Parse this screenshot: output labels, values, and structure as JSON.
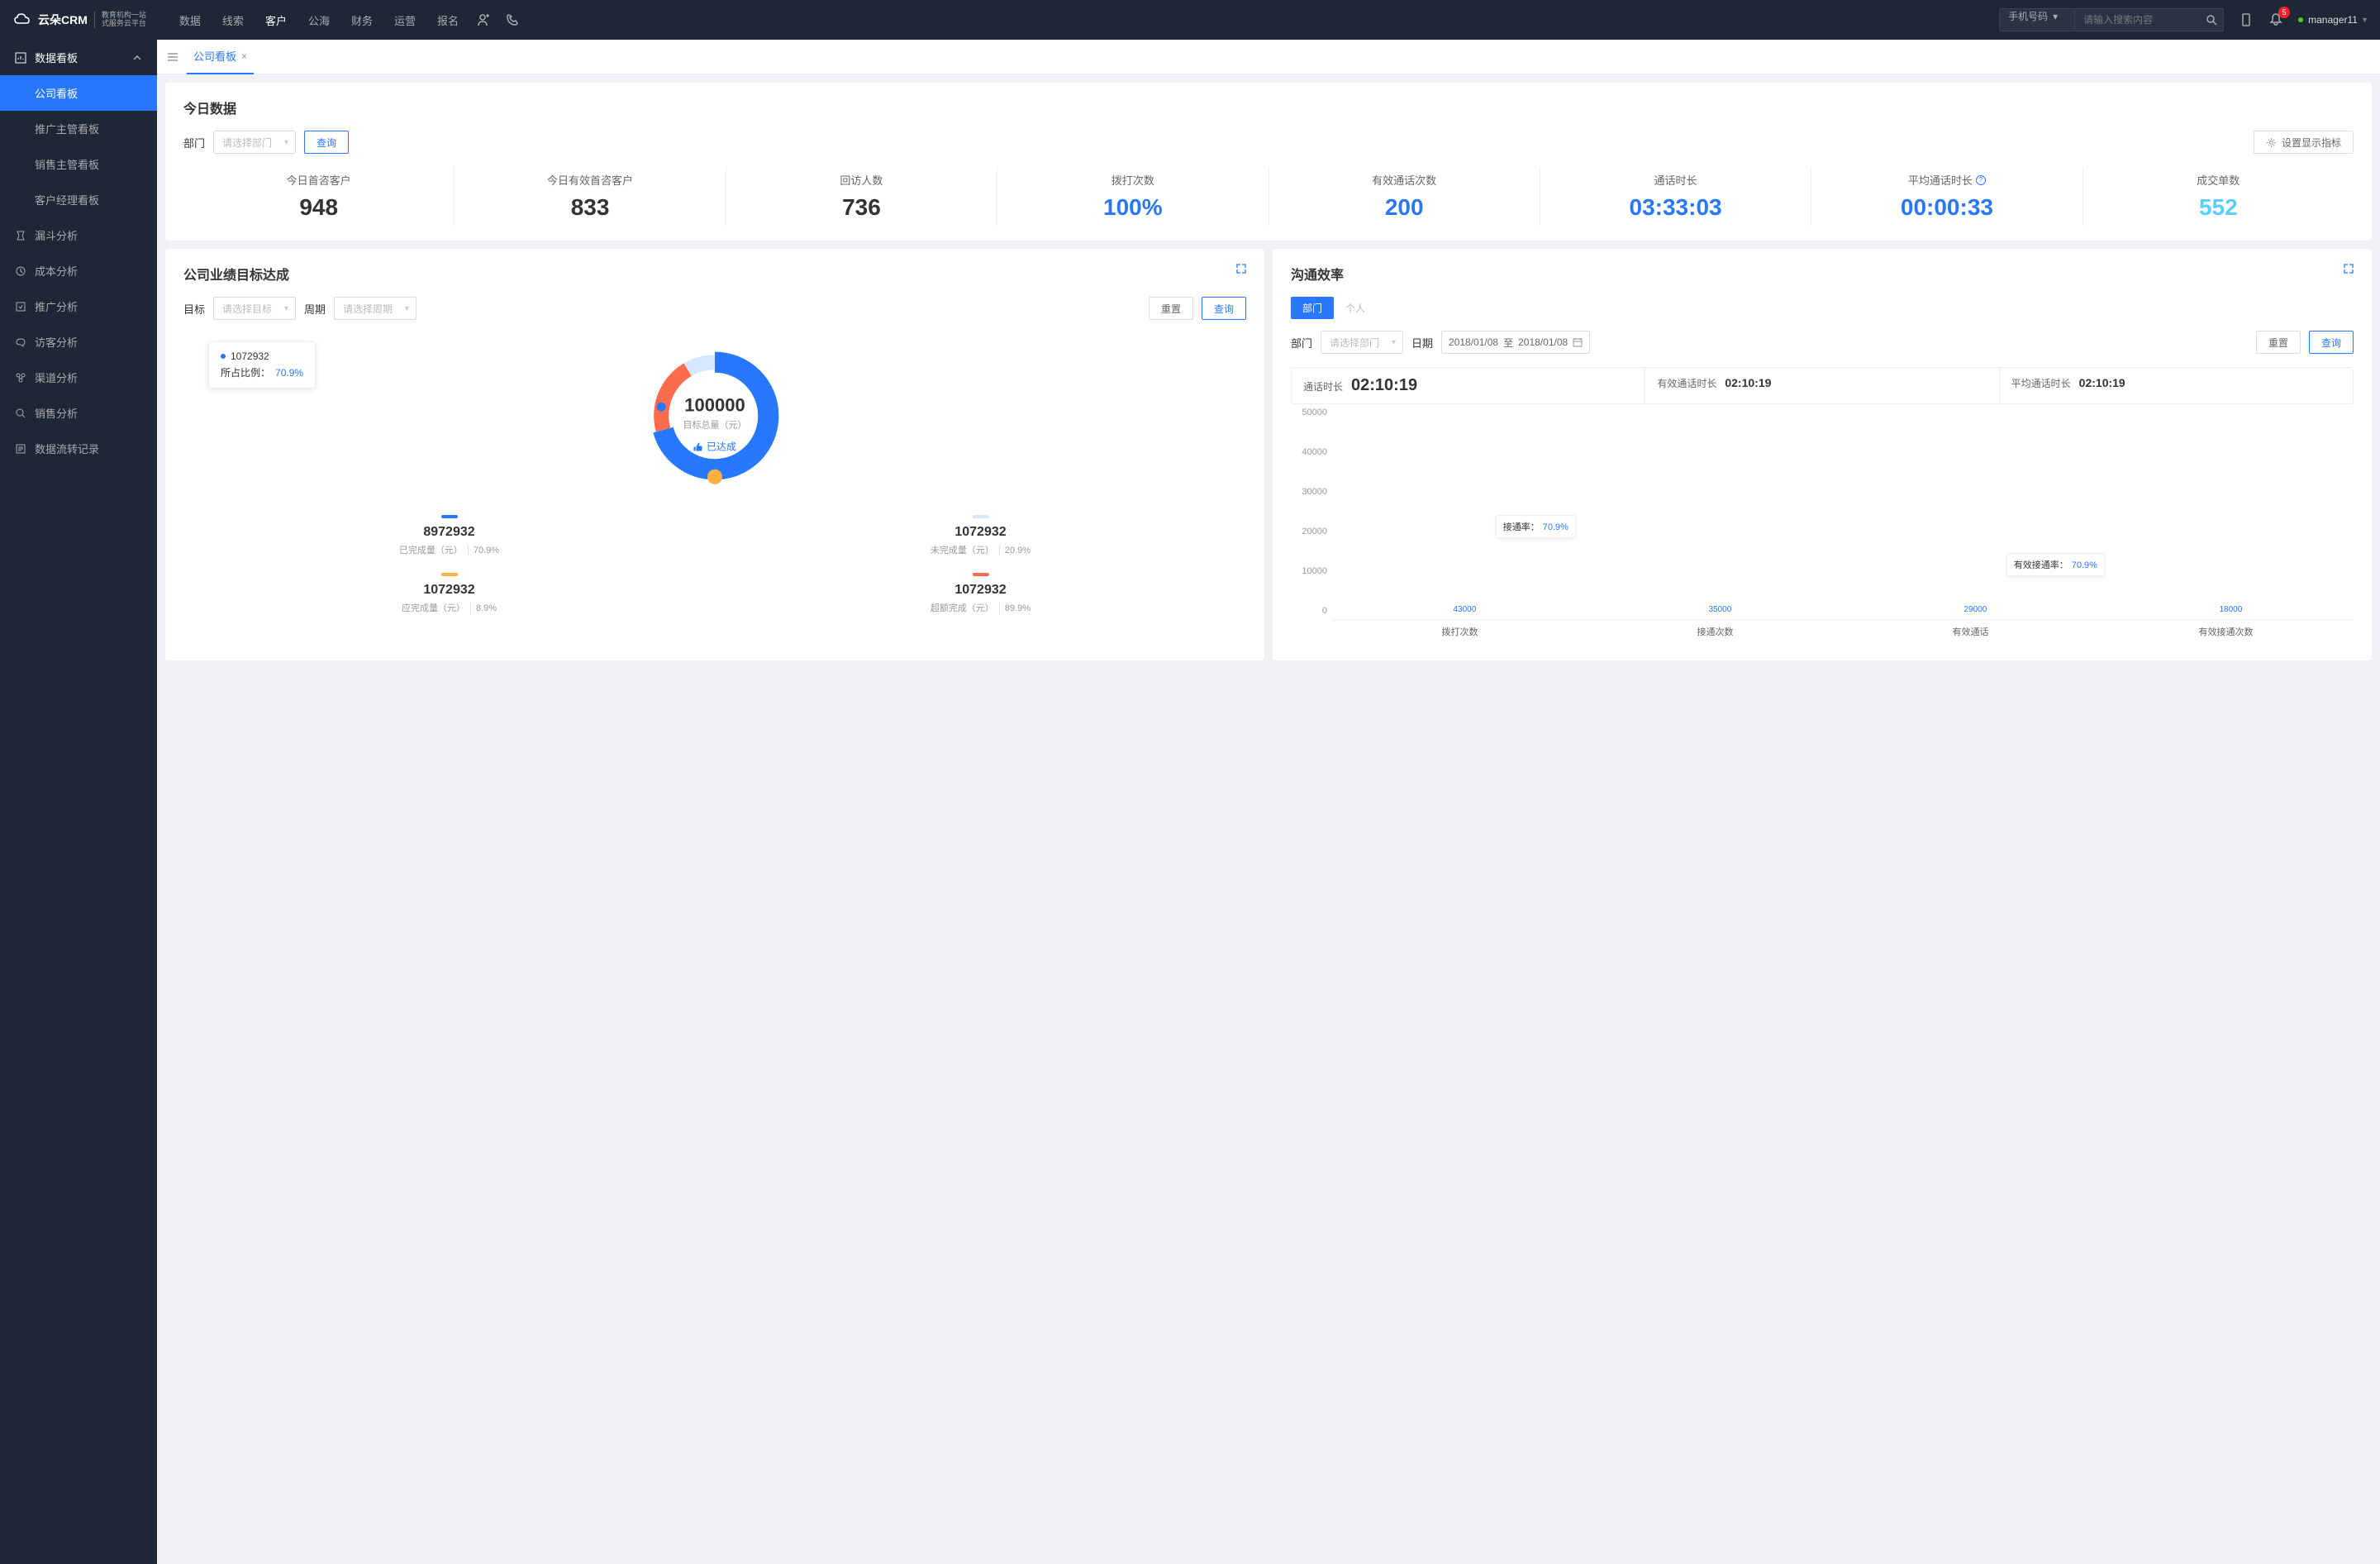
{
  "header": {
    "logo": "云朵CRM",
    "logo_sub": "教育机构一站\n式服务云平台",
    "nav": [
      "数据",
      "线索",
      "客户",
      "公海",
      "财务",
      "运营",
      "报名"
    ],
    "active_nav": 2,
    "search_type": "手机号码",
    "search_placeholder": "请输入搜索内容",
    "badge": "5",
    "user": "manager11"
  },
  "sidebar": {
    "category": "数据看板",
    "subs": [
      "公司看板",
      "推广主管看板",
      "销售主管看板",
      "客户经理看板"
    ],
    "active_sub": 0,
    "items": [
      "漏斗分析",
      "成本分析",
      "推广分析",
      "访客分析",
      "渠道分析",
      "销售分析",
      "数据流转记录"
    ]
  },
  "tabs": {
    "active": "公司看板"
  },
  "today": {
    "title": "今日数据",
    "filter_label": "部门",
    "filter_placeholder": "请选择部门",
    "query_btn": "查询",
    "settings_btn": "设置显示指标",
    "kpis": [
      {
        "label": "今日首咨客户",
        "value": "948",
        "color": "#333"
      },
      {
        "label": "今日有效首咨客户",
        "value": "833",
        "color": "#333"
      },
      {
        "label": "回访人数",
        "value": "736",
        "color": "#333"
      },
      {
        "label": "拨打次数",
        "value": "100%",
        "color": "#2878ff"
      },
      {
        "label": "有效通话次数",
        "value": "200",
        "color": "#2878ff"
      },
      {
        "label": "通话时长",
        "value": "03:33:03",
        "color": "#2878ff"
      },
      {
        "label": "平均通话时长",
        "value": "00:00:33",
        "color": "#2878ff",
        "help": true
      },
      {
        "label": "成交单数",
        "value": "552",
        "color": "#5acfff"
      }
    ]
  },
  "goal": {
    "title": "公司业绩目标达成",
    "target_label": "目标",
    "target_placeholder": "请选择目标",
    "period_label": "周期",
    "period_placeholder": "请选择周期",
    "reset_btn": "重置",
    "query_btn": "查询",
    "tooltip_value": "1072932",
    "tooltip_ratio_label": "所占比例：",
    "tooltip_ratio": "70.9%",
    "center_value": "100000",
    "center_label": "目标总量（元）",
    "status": "已达成",
    "legends": [
      {
        "bar": "#2878ff",
        "value": "8972932",
        "label": "已完成量（元）",
        "pct": "70.9%"
      },
      {
        "bar": "#d6e8ff",
        "value": "1072932",
        "label": "未完成量（元）",
        "pct": "20.9%"
      },
      {
        "bar": "#ffb040",
        "value": "1072932",
        "label": "应完成量（元）",
        "pct": "8.9%"
      },
      {
        "bar": "#ff6b4d",
        "value": "1072932",
        "label": "超额完成（元）",
        "pct": "89.9%"
      }
    ]
  },
  "comm": {
    "title": "沟通效率",
    "tab_dept": "部门",
    "tab_person": "个人",
    "dept_label": "部门",
    "dept_placeholder": "请选择部门",
    "date_label": "日期",
    "date_from": "2018/01/08",
    "date_to": "2018/01/08",
    "date_sep": "至",
    "reset_btn": "重置",
    "query_btn": "查询",
    "stats": [
      {
        "label": "通话时长",
        "value": "02:10:19",
        "big": true
      },
      {
        "label": "有效通话时长",
        "value": "02:10:19"
      },
      {
        "label": "平均通话时长",
        "value": "02:10:19"
      }
    ],
    "float1_label": "接通率：",
    "float1_pct": "70.9%",
    "float2_label": "有效接通率：",
    "float2_pct": "70.9%"
  },
  "chart_data": [
    {
      "type": "pie",
      "title": "公司业绩目标达成",
      "center_value": 100000,
      "center_label": "目标总量（元）",
      "annotations": [
        {
          "segment": "1072932",
          "ratio": 70.9
        }
      ],
      "series": [
        {
          "name": "已完成量（元）",
          "value": 8972932,
          "pct": 70.9,
          "color": "#2878ff"
        },
        {
          "name": "未完成量（元）",
          "value": 1072932,
          "pct": 20.9,
          "color": "#d6e8ff"
        },
        {
          "name": "应完成量（元）",
          "value": 1072932,
          "pct": 8.9,
          "color": "#ffb040"
        },
        {
          "name": "超额完成（元）",
          "value": 1072932,
          "pct": 89.9,
          "color": "#ff6b4d"
        }
      ]
    },
    {
      "type": "bar",
      "title": "沟通效率",
      "categories": [
        "拨打次数",
        "接通次数",
        "有效通话",
        "有效接通次数"
      ],
      "values": [
        43000,
        35000,
        29000,
        18000
      ],
      "ylim": [
        0,
        50000
      ],
      "yticks": [
        0,
        10000,
        20000,
        30000,
        40000,
        50000
      ],
      "annotations": [
        {
          "label": "接通率：",
          "value": "70.9%",
          "between": [
            0,
            1
          ]
        },
        {
          "label": "有效接通率：",
          "value": "70.9%",
          "between": [
            2,
            3
          ]
        }
      ]
    }
  ]
}
